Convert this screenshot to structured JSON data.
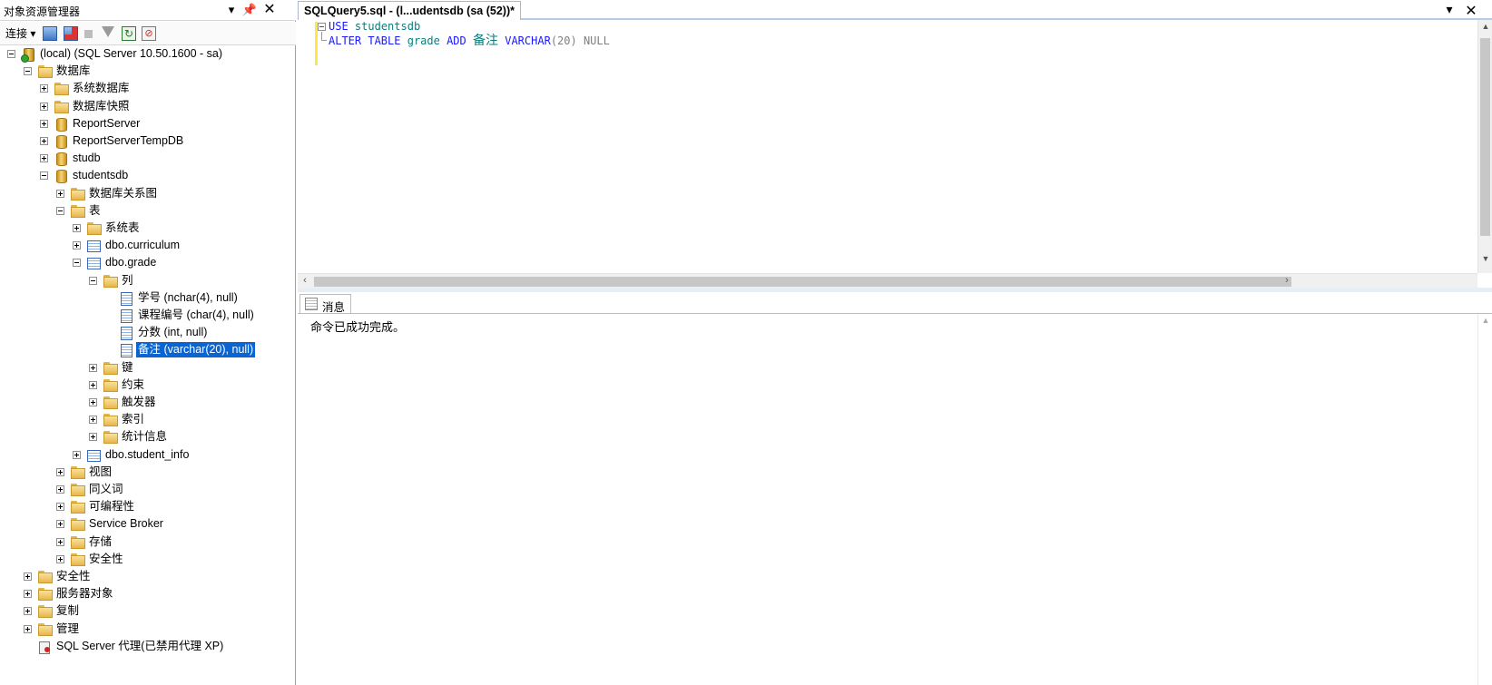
{
  "object_explorer": {
    "title": "对象资源管理器",
    "toolbar": {
      "connect_label": "连接"
    },
    "tree": [
      {
        "label": "(local) (SQL Server 10.50.1600 - sa)",
        "icon": "server-icon",
        "level": 0,
        "expander": "minus"
      },
      {
        "label": "数据库",
        "icon": "folder-icon",
        "level": 1,
        "expander": "minus"
      },
      {
        "label": "系统数据库",
        "icon": "folder-icon",
        "level": 2,
        "expander": "plus"
      },
      {
        "label": "数据库快照",
        "icon": "folder-icon",
        "level": 2,
        "expander": "plus"
      },
      {
        "label": "ReportServer",
        "icon": "database-icon",
        "level": 2,
        "expander": "plus"
      },
      {
        "label": "ReportServerTempDB",
        "icon": "database-icon",
        "level": 2,
        "expander": "plus"
      },
      {
        "label": "studb",
        "icon": "database-icon",
        "level": 2,
        "expander": "plus"
      },
      {
        "label": "studentsdb",
        "icon": "database-icon",
        "level": 2,
        "expander": "minus"
      },
      {
        "label": "数据库关系图",
        "icon": "folder-icon",
        "level": 3,
        "expander": "plus"
      },
      {
        "label": "表",
        "icon": "folder-icon",
        "level": 3,
        "expander": "minus"
      },
      {
        "label": "系统表",
        "icon": "folder-icon",
        "level": 4,
        "expander": "plus"
      },
      {
        "label": "dbo.curriculum",
        "icon": "table-icon",
        "level": 4,
        "expander": "plus"
      },
      {
        "label": "dbo.grade",
        "icon": "table-icon",
        "level": 4,
        "expander": "minus"
      },
      {
        "label": "列",
        "icon": "folder-icon",
        "level": 5,
        "expander": "minus"
      },
      {
        "label": "学号 (nchar(4), null)",
        "icon": "column-icon",
        "level": 6,
        "expander": "none"
      },
      {
        "label": "课程编号 (char(4), null)",
        "icon": "column-icon",
        "level": 6,
        "expander": "none"
      },
      {
        "label": "分数 (int, null)",
        "icon": "column-icon",
        "level": 6,
        "expander": "none"
      },
      {
        "label": "备注 (varchar(20), null)",
        "icon": "column-icon",
        "level": 6,
        "expander": "none",
        "selected": true
      },
      {
        "label": "键",
        "icon": "folder-icon",
        "level": 5,
        "expander": "plus"
      },
      {
        "label": "约束",
        "icon": "folder-icon",
        "level": 5,
        "expander": "plus"
      },
      {
        "label": "触发器",
        "icon": "folder-icon",
        "level": 5,
        "expander": "plus"
      },
      {
        "label": "索引",
        "icon": "folder-icon",
        "level": 5,
        "expander": "plus"
      },
      {
        "label": "统计信息",
        "icon": "folder-icon",
        "level": 5,
        "expander": "plus"
      },
      {
        "label": "dbo.student_info",
        "icon": "table-icon",
        "level": 4,
        "expander": "plus"
      },
      {
        "label": "视图",
        "icon": "folder-icon",
        "level": 3,
        "expander": "plus"
      },
      {
        "label": "同义词",
        "icon": "folder-icon",
        "level": 3,
        "expander": "plus"
      },
      {
        "label": "可编程性",
        "icon": "folder-icon",
        "level": 3,
        "expander": "plus"
      },
      {
        "label": "Service Broker",
        "icon": "folder-icon",
        "level": 3,
        "expander": "plus"
      },
      {
        "label": "存储",
        "icon": "folder-icon",
        "level": 3,
        "expander": "plus"
      },
      {
        "label": "安全性",
        "icon": "folder-icon",
        "level": 3,
        "expander": "plus"
      },
      {
        "label": "安全性",
        "icon": "folder-icon",
        "level": 1,
        "expander": "plus"
      },
      {
        "label": "服务器对象",
        "icon": "folder-icon",
        "level": 1,
        "expander": "plus"
      },
      {
        "label": "复制",
        "icon": "folder-icon",
        "level": 1,
        "expander": "plus"
      },
      {
        "label": "管理",
        "icon": "folder-icon",
        "level": 1,
        "expander": "plus"
      },
      {
        "label": "SQL Server 代理(已禁用代理 XP)",
        "icon": "agent-icon",
        "level": 1,
        "expander": "none"
      }
    ]
  },
  "editor": {
    "tab_title": "SQLQuery5.sql - (l...udentsdb (sa (52))*",
    "code": {
      "line1": {
        "kw": "USE",
        "db": "studentsdb"
      },
      "line2": {
        "alter": "ALTER TABLE",
        "table": "grade",
        "add": "ADD",
        "column": "备注",
        "type": "VARCHAR",
        "size": "(20)",
        "null": "NULL"
      }
    }
  },
  "results": {
    "tab_label": "消息",
    "message": "命令已成功完成。"
  },
  "colors": {
    "selection": "#0a64d2",
    "keyword": "#1a1aff",
    "identifier": "#0a7d7d",
    "change_bar": "#ffe64a"
  }
}
